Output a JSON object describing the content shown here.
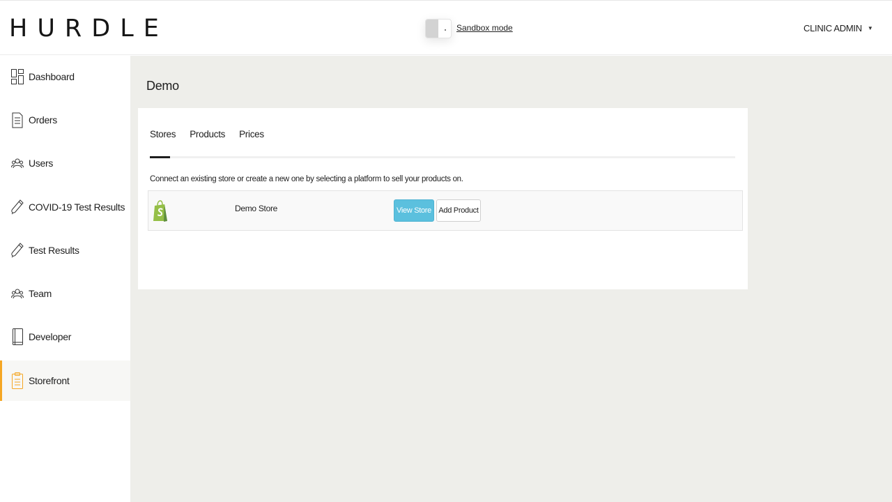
{
  "header": {
    "logo": "HURDLE",
    "sandbox_label": "Sandbox mode",
    "user_menu": "CLINIC ADMIN",
    "caret": "▼"
  },
  "sidebar": {
    "items": [
      {
        "label": "Dashboard",
        "icon": "dashboard-icon"
      },
      {
        "label": "Orders",
        "icon": "orders-icon"
      },
      {
        "label": "Users",
        "icon": "users-icon"
      },
      {
        "label": "COVID-19 Test Results",
        "icon": "test-tube-icon"
      },
      {
        "label": "Test Results",
        "icon": "test-tube-icon"
      },
      {
        "label": "Team",
        "icon": "team-icon"
      },
      {
        "label": "Developer",
        "icon": "developer-icon"
      },
      {
        "label": "Storefront",
        "icon": "clipboard-icon",
        "active": true
      }
    ]
  },
  "main": {
    "page_title": "Demo",
    "tabs": [
      {
        "label": "Stores",
        "active": true
      },
      {
        "label": "Products"
      },
      {
        "label": "Prices"
      }
    ],
    "helper_text": "Connect an existing store or create a new one by selecting a platform to sell your products on.",
    "stores": [
      {
        "platform_icon": "shopify-icon",
        "name": "Demo Store",
        "view_label": "View Store",
        "add_label": "Add Product"
      }
    ]
  },
  "colors": {
    "accent": "#f5a623",
    "button_primary": "#5bc0de",
    "main_background": "#eeeeea",
    "shopify_green": "#95bf47"
  }
}
